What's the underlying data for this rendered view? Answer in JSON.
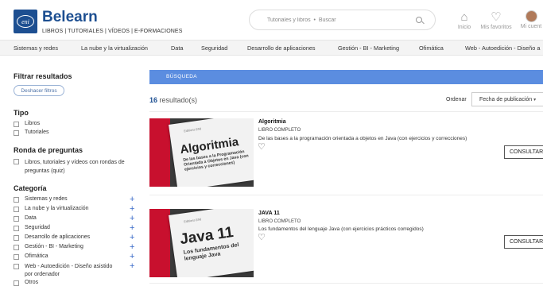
{
  "header": {
    "brand_logo": "eni",
    "brand_name": "Belearn",
    "brand_tagline": "LIBROS | TUTORIALES | VÍDEOS | E-FORMACIONES",
    "search_placeholder": "Tutoriales y libros  •  Buscar",
    "icons": [
      {
        "name": "home-icon",
        "label": "Inicio"
      },
      {
        "name": "heart-icon",
        "label": "Mis favoritos"
      },
      {
        "name": "avatar",
        "label": "Mi cuent"
      }
    ]
  },
  "nav": [
    "Sistemas y redes",
    "La nube y la virtualización",
    "Data",
    "Seguridad",
    "Desarrollo de aplicaciones",
    "Gestión - BI - Marketing",
    "Ofimática",
    "Web - Autoedición - Diseño a"
  ],
  "sidebar": {
    "filter_title": "Filtrar resultados",
    "undo_label": "Deshacer filtros",
    "tipo_title": "Tipo",
    "tipo_items": [
      "Libros",
      "Tutoriales"
    ],
    "ronda_title": "Ronda de preguntas",
    "ronda_item_line1": "Libros, tutoriales y vídeos con rondas de",
    "ronda_item_line2": "preguntas (quiz)",
    "categoria_title": "Categoría",
    "categorias": [
      "Sistemas y redes",
      "La nube y la virtualización",
      "Data",
      "Seguridad",
      "Desarrollo de aplicaciones",
      "Gestión - BI - Marketing",
      "Ofimática"
    ],
    "categoria_web_line1": "Web - Autoedición - Diseño asistido",
    "categoria_web_line2": "por ordenador",
    "categoria_last": "Otros"
  },
  "main": {
    "banner": "BÚSQUEDA",
    "count": "16",
    "count_suffix": " resultado(s)",
    "order_label": "Ordenar",
    "order_value": "Fecha de publicación",
    "results": [
      {
        "title": "Algoritmia",
        "kind": "LIBRO COMPLETO",
        "description": "De las bases a la programación orientada a objetos en Java (con ejercicios y correcciones)",
        "cover_title": "Algoritmia",
        "cover_subtitle": "De las bases a la Programación Orientada a Objetos en Java (con ejercicios y correcciones)",
        "button": "CONSULTAR"
      },
      {
        "title": "JAVA 11",
        "kind": "LIBRO COMPLETO",
        "description": "Los fundamentos del lenguaje Java (con ejercicios prácticos corregidos)",
        "cover_title": "Java 11",
        "cover_subtitle": "Los fundamentos del lenguaje Java",
        "button": "CONSULTAR"
      }
    ]
  },
  "colors": {
    "brand": "#1d4f91",
    "banner": "#5b8de0",
    "plus": "#3b6bc9",
    "cover_red": "#c8102e"
  }
}
